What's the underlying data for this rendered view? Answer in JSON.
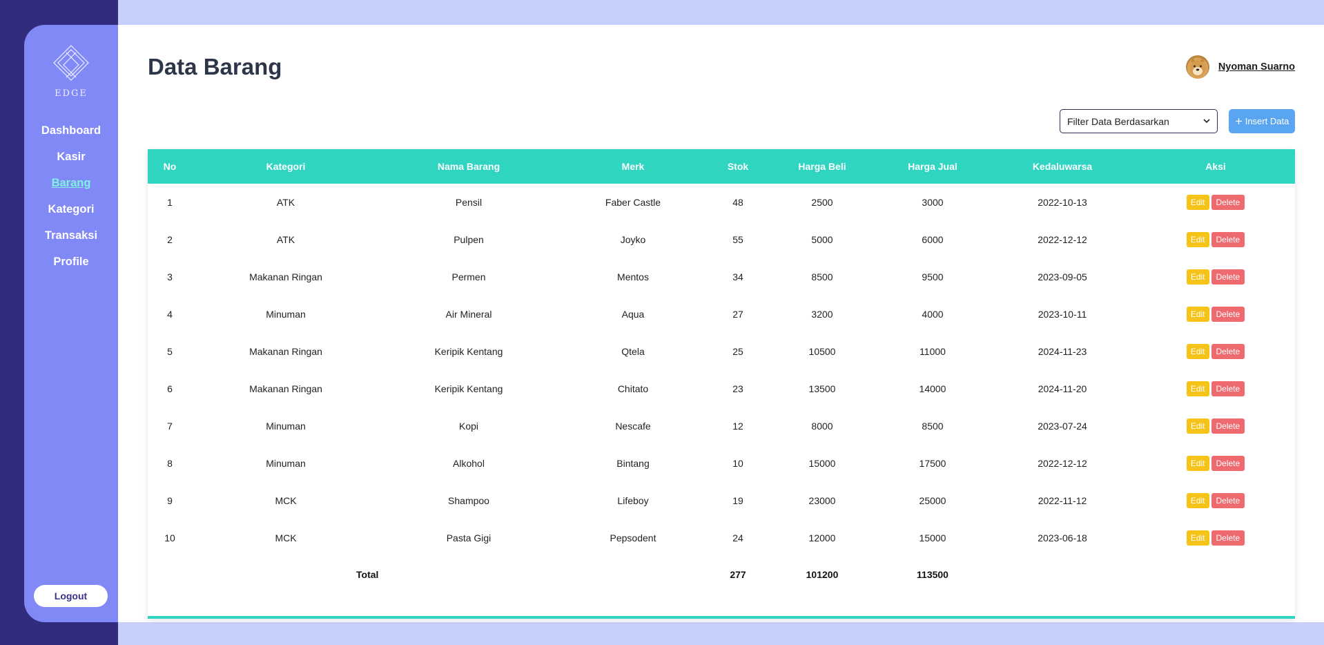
{
  "sidebar": {
    "logo_text": "EDGE",
    "items": [
      {
        "label": "Dashboard"
      },
      {
        "label": "Kasir"
      },
      {
        "label": "Barang",
        "active": true
      },
      {
        "label": "Kategori"
      },
      {
        "label": "Transaksi"
      },
      {
        "label": "Profile"
      }
    ],
    "logout_label": "Logout"
  },
  "header": {
    "title": "Data Barang",
    "user_name": "Nyoman Suarno"
  },
  "toolbar": {
    "filter_selected": "Filter Data Berdasarkan",
    "insert_label": "Insert Data"
  },
  "table": {
    "columns": [
      "No",
      "Kategori",
      "Nama Barang",
      "Merk",
      "Stok",
      "Harga Beli",
      "Harga Jual",
      "Kedaluwarsa",
      "Aksi"
    ],
    "rows": [
      [
        "1",
        "ATK",
        "Pensil",
        "Faber Castle",
        "48",
        "2500",
        "3000",
        "2022-10-13"
      ],
      [
        "2",
        "ATK",
        "Pulpen",
        "Joyko",
        "55",
        "5000",
        "6000",
        "2022-12-12"
      ],
      [
        "3",
        "Makanan Ringan",
        "Permen",
        "Mentos",
        "34",
        "8500",
        "9500",
        "2023-09-05"
      ],
      [
        "4",
        "Minuman",
        "Air Mineral",
        "Aqua",
        "27",
        "3200",
        "4000",
        "2023-10-11"
      ],
      [
        "5",
        "Makanan Ringan",
        "Keripik Kentang",
        "Qtela",
        "25",
        "10500",
        "11000",
        "2024-11-23"
      ],
      [
        "6",
        "Makanan Ringan",
        "Keripik Kentang",
        "Chitato",
        "23",
        "13500",
        "14000",
        "2024-11-20"
      ],
      [
        "7",
        "Minuman",
        "Kopi",
        "Nescafe",
        "12",
        "8000",
        "8500",
        "2023-07-24"
      ],
      [
        "8",
        "Minuman",
        "Alkohol",
        "Bintang",
        "10",
        "15000",
        "17500",
        "2022-12-12"
      ],
      [
        "9",
        "MCK",
        "Shampoo",
        "Lifeboy",
        "19",
        "23000",
        "25000",
        "2022-11-12"
      ],
      [
        "10",
        "MCK",
        "Pasta Gigi",
        "Pepsodent",
        "24",
        "12000",
        "15000",
        "2023-06-18"
      ]
    ],
    "edit_label": "Edit",
    "delete_label": "Delete",
    "footer": {
      "label": "Total",
      "stok": "277",
      "harga_beli": "101200",
      "harga_jual": "113500"
    }
  },
  "colors": {
    "sidebar_bg": "#8189f7",
    "strip_bg": "#322c7f",
    "page_bg": "#c7cffc",
    "table_header": "#2fd5c0",
    "edit": "#f6c418",
    "delete": "#ee6a6f",
    "insert": "#5aa5f2",
    "active_nav": "#7ff0e3"
  }
}
